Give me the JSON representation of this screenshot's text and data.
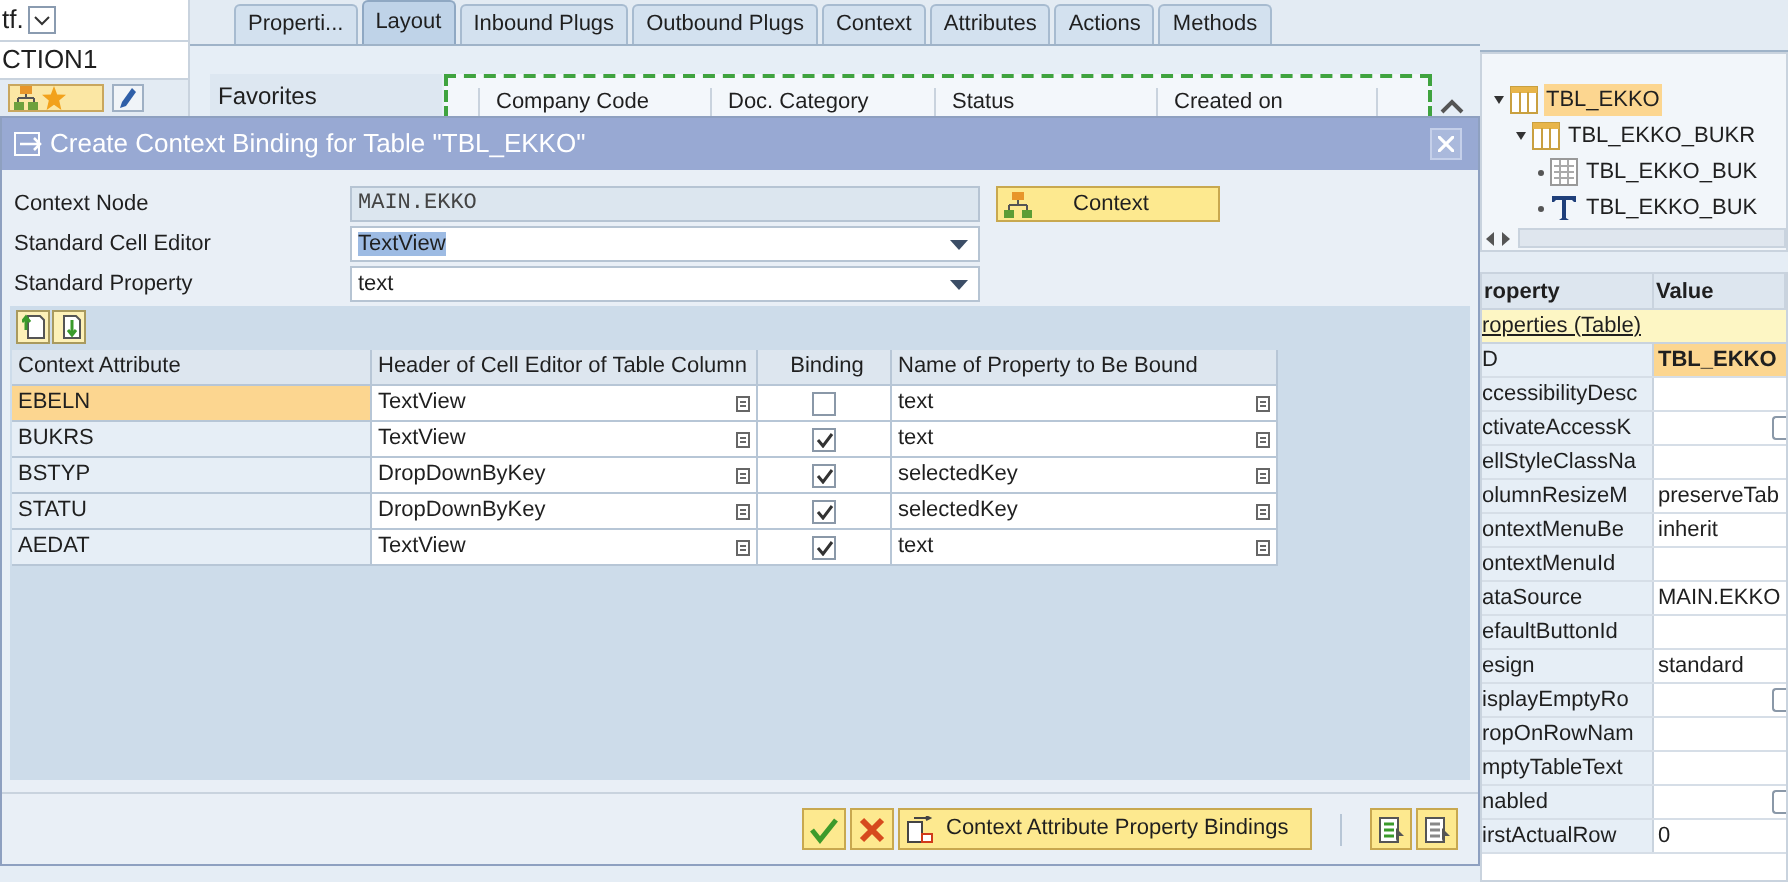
{
  "left_strip": {
    "dropdown_value": "tf.",
    "field_value": "CTION1"
  },
  "tabs": [
    {
      "label": "Properti...",
      "selected": false
    },
    {
      "label": "Layout",
      "selected": true
    },
    {
      "label": "Inbound Plugs",
      "selected": false
    },
    {
      "label": "Outbound Plugs",
      "selected": false
    },
    {
      "label": "Context",
      "selected": false
    },
    {
      "label": "Attributes",
      "selected": false
    },
    {
      "label": "Actions",
      "selected": false
    },
    {
      "label": "Methods",
      "selected": false
    }
  ],
  "layout_preview": {
    "favorites_label": "Favorites",
    "columns": [
      "Company Code",
      "Doc. Category",
      "Status",
      "Created on"
    ]
  },
  "dialog": {
    "title": "Create Context Binding for Table \"TBL_EKKO\"",
    "fields": [
      {
        "label": "Context Node",
        "kind": "readonly",
        "value": "MAIN.EKKO"
      },
      {
        "label": "Standard Cell Editor",
        "kind": "dropdown",
        "value": "TextView",
        "text_selected": true
      },
      {
        "label": "Standard Property",
        "kind": "dropdown",
        "value": "text"
      }
    ],
    "context_button": "Context",
    "table": {
      "columns": [
        "Context Attribute",
        "Header of Cell Editor of Table Column",
        "Binding",
        "Name of Property to Be Bound"
      ],
      "rows": [
        {
          "attribute": "EBELN",
          "cell_editor": "TextView",
          "binding": false,
          "property": "text",
          "selected": true
        },
        {
          "attribute": "BUKRS",
          "cell_editor": "TextView",
          "binding": true,
          "property": "text",
          "selected": false
        },
        {
          "attribute": "BSTYP",
          "cell_editor": "DropDownByKey",
          "binding": true,
          "property": "selectedKey",
          "selected": false
        },
        {
          "attribute": "STATU",
          "cell_editor": "DropDownByKey",
          "binding": true,
          "property": "selectedKey",
          "selected": false
        },
        {
          "attribute": "AEDAT",
          "cell_editor": "TextView",
          "binding": true,
          "property": "text",
          "selected": false
        }
      ]
    },
    "bindings_button": "Context Attribute Property Bindings"
  },
  "tree": [
    {
      "label": "TBL_EKKO",
      "kind": "table",
      "selected": true,
      "children": [
        {
          "label": "TBL_EKKO_BUKR",
          "kind": "table",
          "selected": false,
          "children": [
            {
              "label": "TBL_EKKO_BUK",
              "kind": "column",
              "selected": false
            },
            {
              "label": "TBL_EKKO_BUK",
              "kind": "text",
              "selected": false
            }
          ]
        }
      ]
    }
  ],
  "properties": {
    "columns": [
      "roperty",
      "Value"
    ],
    "group": "roperties (Table)",
    "rows": [
      {
        "property": "D",
        "value": "TBL_EKKO",
        "kind": "text",
        "selected": true
      },
      {
        "property": "ccessibilityDesc",
        "kind": "text",
        "selected": false
      },
      {
        "property": "ctivateAccessK",
        "kind": "checkbox",
        "selected": false
      },
      {
        "property": "ellStyleClassNa",
        "kind": "text",
        "selected": false
      },
      {
        "property": "olumnResizeM",
        "value": "preserveTab",
        "kind": "text",
        "selected": false
      },
      {
        "property": "ontextMenuBe",
        "value": "inherit",
        "kind": "text",
        "selected": false
      },
      {
        "property": "ontextMenuId",
        "kind": "text",
        "selected": false
      },
      {
        "property": "ataSource",
        "value": "MAIN.EKKO",
        "kind": "text",
        "selected": false
      },
      {
        "property": "efaultButtonId",
        "kind": "text",
        "selected": false
      },
      {
        "property": "esign",
        "value": "standard",
        "kind": "text",
        "selected": false
      },
      {
        "property": "isplayEmptyRo",
        "kind": "checkbox",
        "selected": false
      },
      {
        "property": "ropOnRowNam",
        "kind": "text",
        "selected": false
      },
      {
        "property": "mptyTableText",
        "kind": "text",
        "selected": false
      },
      {
        "property": "nabled",
        "kind": "checkbox",
        "selected": false
      },
      {
        "property": "irstActualRow",
        "value": "0",
        "kind": "text",
        "selected": false
      }
    ]
  }
}
